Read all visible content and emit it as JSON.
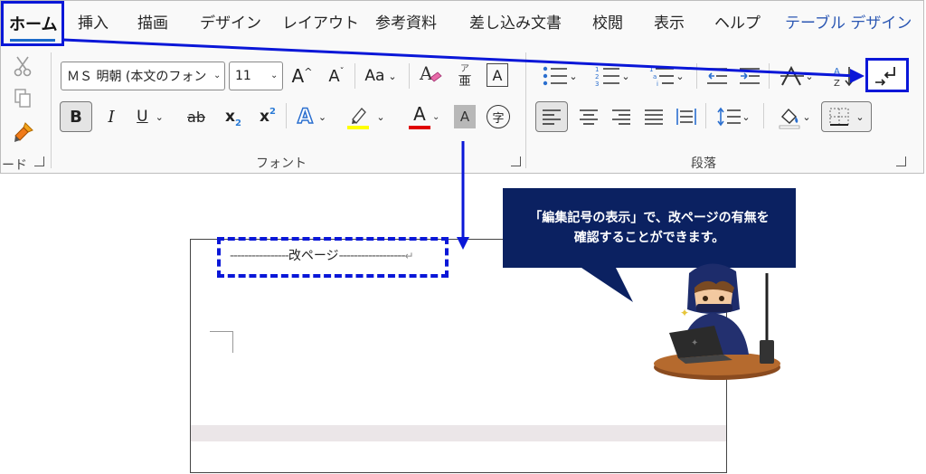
{
  "tabs": {
    "home": "ホーム",
    "items": [
      "挿入",
      "描画",
      "デザイン",
      "レイアウト",
      "参考資料",
      "差し込み文書",
      "校閲",
      "表示",
      "ヘルプ",
      "テーブル デザイン"
    ]
  },
  "font": {
    "name": "ＭＳ 明朝 (本文のフォン",
    "size": "11",
    "grow": "A",
    "shrink": "A",
    "case": "Aa",
    "phonetic_top": "ア",
    "phonetic_bottom": "亜",
    "border_char": "A",
    "bold": "B",
    "italic": "I",
    "underline": "U",
    "strike": "ab",
    "subscript": "x",
    "superscript": "x",
    "effect": "A",
    "color_letter": "A",
    "shading": "A",
    "enclose": "字"
  },
  "groups": {
    "clipboard": "ード",
    "font": "フォント",
    "paragraph": "段落"
  },
  "document": {
    "page_break": "改ページ",
    "dashes_left": "----------------",
    "dashes_right": "------------------"
  },
  "callout": {
    "line1": "「編集記号の表示」で、改ページの有無を",
    "line2": "確認することができます。"
  },
  "colors": {
    "highlight_box": "#0a17d8",
    "arrow": "#0a17d8",
    "callout_bg": "#0b2161",
    "font_color_bar": "#e00000",
    "highlighter_bar": "#ffff00",
    "accent_tab": "#2b57b3"
  },
  "icons": [
    "cut-icon",
    "copy-icon",
    "format-painter-icon",
    "bullets-icon",
    "numbering-icon",
    "multilevel-list-icon",
    "decrease-indent-icon",
    "increase-indent-icon",
    "asian-layout-icon",
    "sort-icon",
    "show-formatting-marks-icon",
    "align-left-icon",
    "center-icon",
    "align-right-icon",
    "justify-icon",
    "distributed-icon",
    "line-spacing-icon",
    "shading-icon",
    "borders-icon",
    "ninja-illustration"
  ]
}
